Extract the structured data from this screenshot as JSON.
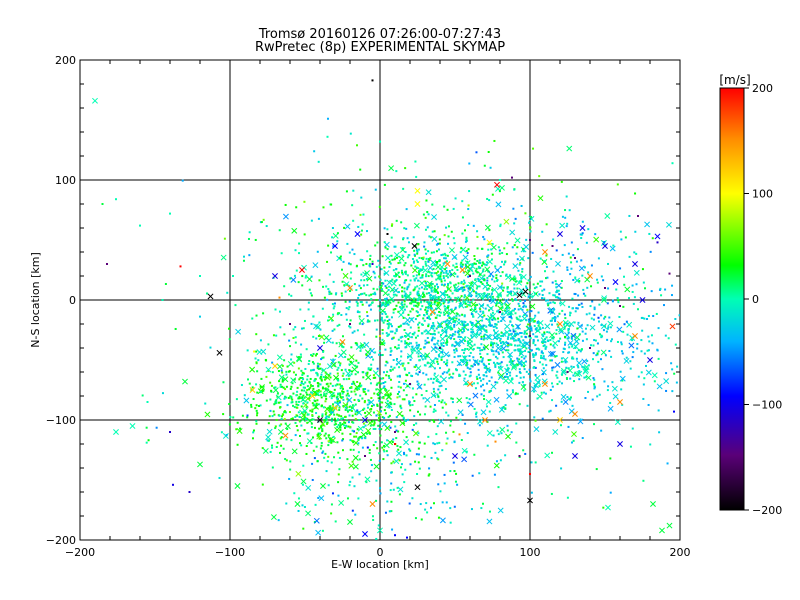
{
  "title_lines": [
    "Tromsø 20160126 07:26:00-07:27:43",
    "RwPretec (8p) EXPERIMENTAL SKYMAP"
  ],
  "chart_data": {
    "type": "scatter",
    "title": "Tromsø 20160126 07:26:00-07:27:43",
    "subtitle": "RwPretec (8p) EXPERIMENTAL SKYMAP",
    "xlabel": "E-W location [km]",
    "ylabel": "N-S location [km]",
    "xlim": [
      -200,
      200
    ],
    "ylim": [
      -200,
      200
    ],
    "xticks": [
      -200,
      -100,
      0,
      100,
      200
    ],
    "yticks": [
      -200,
      -100,
      0,
      100,
      200
    ],
    "xtick_labels": [
      "−200",
      "−100",
      "0",
      "100",
      "200"
    ],
    "ytick_labels": [
      "−200",
      "−100",
      "0",
      "100",
      "200"
    ],
    "grid": true,
    "colorbar": {
      "label": "[m/s]",
      "range": [
        -200,
        200
      ],
      "ticks": [
        200,
        100,
        0,
        -100,
        -200
      ],
      "tick_labels": [
        "200",
        "100",
        "0",
        "−100",
        "−200"
      ],
      "colormap": "rainbow (black-purple-blue-cyan-green-yellow-red)"
    },
    "markers": {
      "small": "dot",
      "large": "x"
    },
    "points": [
      [
        -190,
        166,
        0,
        "x"
      ],
      [
        -182,
        30,
        -150,
        "d"
      ],
      [
        -133,
        28,
        200,
        "d"
      ],
      [
        -113,
        3,
        -200,
        "x"
      ],
      [
        -107,
        -44,
        -200,
        "x"
      ],
      [
        -67,
        2,
        150,
        "d"
      ],
      [
        -52,
        25,
        200,
        "x"
      ],
      [
        -40,
        -100,
        -180,
        "x"
      ],
      [
        -130,
        -68,
        20,
        "x"
      ],
      [
        -120,
        -137,
        20,
        "x"
      ],
      [
        -95,
        -155,
        20,
        "x"
      ],
      [
        -140,
        -110,
        -120,
        "d"
      ],
      [
        -127,
        -160,
        -120,
        "d"
      ],
      [
        -138,
        -154,
        -110,
        "d"
      ],
      [
        -176,
        -110,
        0,
        "x"
      ],
      [
        -165,
        -105,
        0,
        "x"
      ],
      [
        -185,
        80,
        20,
        "d"
      ],
      [
        -176,
        84,
        0,
        "d"
      ],
      [
        -160,
        62,
        0,
        "d"
      ],
      [
        -140,
        72,
        0,
        "d"
      ],
      [
        -5,
        183,
        -200,
        "d"
      ],
      [
        0,
        132,
        0,
        "d"
      ],
      [
        -35,
        136,
        0,
        "d"
      ],
      [
        80,
        100,
        0,
        "d"
      ],
      [
        25,
        91,
        100,
        "x"
      ],
      [
        25,
        80,
        100,
        "x"
      ],
      [
        78,
        96,
        200,
        "x"
      ],
      [
        88,
        102,
        -150,
        "d"
      ],
      [
        23,
        45,
        -200,
        "x"
      ],
      [
        93,
        4,
        -200,
        "x"
      ],
      [
        97,
        7,
        -200,
        "x"
      ],
      [
        73,
        48,
        100,
        "x"
      ],
      [
        185,
        48,
        -120,
        "d"
      ],
      [
        172,
        70,
        -150,
        "d"
      ],
      [
        185,
        53,
        -100,
        "x"
      ],
      [
        157,
        15,
        -100,
        "x"
      ],
      [
        195,
        -22,
        180,
        "x"
      ],
      [
        193,
        22,
        -150,
        "d"
      ],
      [
        196,
        -93,
        -100,
        "d"
      ],
      [
        195,
        114,
        0,
        "d"
      ],
      [
        182,
        -170,
        20,
        "x"
      ],
      [
        193,
        -188,
        20,
        "x"
      ],
      [
        188,
        -192,
        20,
        "x"
      ],
      [
        152,
        -173,
        0,
        "x"
      ],
      [
        100,
        -167,
        -200,
        "x"
      ],
      [
        25,
        -156,
        -200,
        "x"
      ],
      [
        100,
        -145,
        200,
        "d"
      ],
      [
        93,
        -130,
        -150,
        "d"
      ],
      [
        53,
        -112,
        150,
        "d"
      ],
      [
        77,
        -118,
        150,
        "d"
      ],
      [
        10,
        -120,
        200,
        "d"
      ],
      [
        -5,
        -170,
        150,
        "x"
      ],
      [
        -63,
        -113,
        150,
        "x"
      ],
      [
        -38,
        -155,
        20,
        "x"
      ],
      [
        -55,
        -170,
        20,
        "x"
      ],
      [
        -20,
        -185,
        20,
        "x"
      ],
      [
        0,
        -192,
        0,
        "x"
      ],
      [
        10,
        -196,
        -100,
        "d"
      ],
      [
        18,
        -198,
        -100,
        "d"
      ],
      [
        -10,
        -195,
        -100,
        "x"
      ],
      [
        -155,
        -85,
        0,
        "d"
      ],
      [
        -145,
        0,
        0,
        "d"
      ],
      [
        -120,
        20,
        0,
        "d"
      ],
      [
        -98,
        20,
        0,
        "d"
      ],
      [
        -30,
        45,
        -100,
        "x"
      ],
      [
        -15,
        55,
        -100,
        "x"
      ],
      [
        5,
        55,
        -200,
        "d"
      ],
      [
        -5,
        30,
        -120,
        "d"
      ],
      [
        45,
        30,
        150,
        "x"
      ],
      [
        55,
        25,
        150,
        "x"
      ],
      [
        35,
        -10,
        150,
        "x"
      ],
      [
        -20,
        10,
        150,
        "x"
      ],
      [
        -25,
        -35,
        150,
        "x"
      ],
      [
        60,
        -70,
        150,
        "x"
      ],
      [
        70,
        -100,
        150,
        "x"
      ],
      [
        110,
        -70,
        150,
        "x"
      ],
      [
        130,
        -95,
        150,
        "x"
      ],
      [
        120,
        -100,
        120,
        "x"
      ],
      [
        160,
        -85,
        150,
        "x"
      ],
      [
        0,
        -30,
        120,
        "d"
      ],
      [
        -70,
        -55,
        120,
        "x"
      ],
      [
        -85,
        -75,
        120,
        "x"
      ],
      [
        -45,
        -80,
        120,
        "x"
      ],
      [
        -30,
        -90,
        120,
        "x"
      ],
      [
        170,
        -30,
        150,
        "x"
      ],
      [
        140,
        20,
        150,
        "x"
      ],
      [
        110,
        40,
        150,
        "x"
      ],
      [
        120,
        -20,
        150,
        "x"
      ],
      [
        100,
        50,
        -150,
        "d"
      ],
      [
        115,
        45,
        -150,
        "d"
      ],
      [
        130,
        35,
        -150,
        "d"
      ],
      [
        150,
        10,
        -150,
        "d"
      ],
      [
        160,
        -5,
        -150,
        "d"
      ],
      [
        140,
        -40,
        -150,
        "d"
      ],
      [
        125,
        -60,
        -150,
        "d"
      ],
      [
        100,
        -30,
        -150,
        "d"
      ],
      [
        80,
        -10,
        -150,
        "d"
      ],
      [
        60,
        20,
        -150,
        "d"
      ],
      [
        40,
        -40,
        -150,
        "d"
      ],
      [
        20,
        -70,
        -150,
        "d"
      ],
      [
        10,
        -110,
        -150,
        "d"
      ],
      [
        -10,
        -130,
        -150,
        "d"
      ],
      [
        -20,
        -20,
        -150,
        "d"
      ],
      [
        -60,
        -20,
        -150,
        "d"
      ],
      [
        120,
        55,
        -110,
        "x"
      ],
      [
        135,
        60,
        -110,
        "x"
      ],
      [
        150,
        45,
        -110,
        "x"
      ],
      [
        170,
        30,
        -110,
        "x"
      ],
      [
        175,
        0,
        -110,
        "x"
      ],
      [
        180,
        -50,
        -110,
        "x"
      ],
      [
        160,
        -120,
        -110,
        "x"
      ],
      [
        130,
        -130,
        -110,
        "x"
      ],
      [
        50,
        -130,
        -110,
        "x"
      ],
      [
        -10,
        -100,
        -110,
        "x"
      ],
      [
        -40,
        -40,
        -110,
        "x"
      ],
      [
        -70,
        20,
        -110,
        "x"
      ]
    ]
  }
}
